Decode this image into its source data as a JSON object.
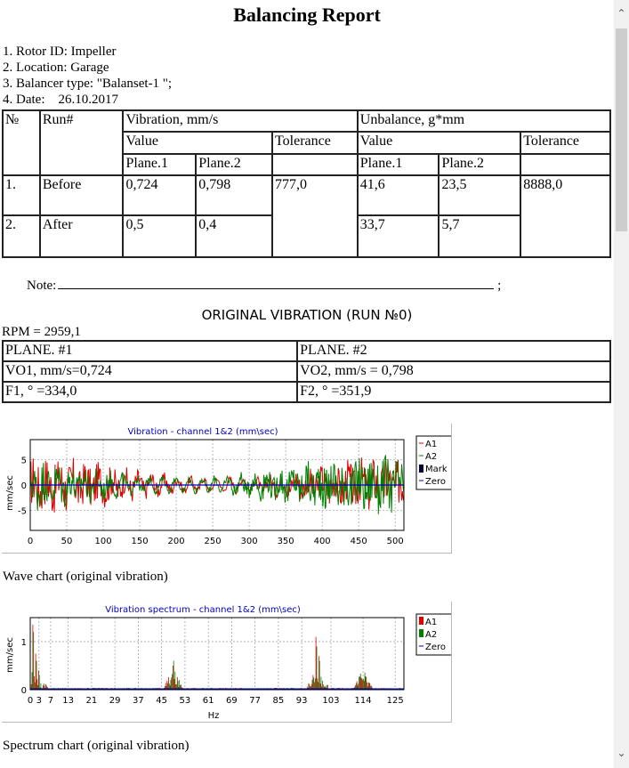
{
  "report": {
    "title": "Balancing Report",
    "info": [
      "1. Rotor ID: Impeller",
      "2. Location: Garage",
      "3. Balancer type: \"Balanset-1 \";",
      "4. Date:    26.10.2017"
    ]
  },
  "run_table": {
    "h_no": "№",
    "h_run": "Run#",
    "h_vib": "Vibration, mm/s",
    "h_unb": "Unbalance, g*mm",
    "h_value": "Value",
    "h_tol": "Tolerance",
    "h_p1": "Plane.1",
    "h_p2": "Plane.2",
    "rows": [
      {
        "no": "1.",
        "run": "Before",
        "v1": "0,724",
        "v2": "0,798",
        "vtol": "777,0",
        "u1": "41,6",
        "u2": "23,5",
        "utol": "8888,0"
      },
      {
        "no": "2.",
        "run": "After",
        "v1": "0,5",
        "v2": "0,4",
        "u1": "33,7",
        "u2": "5,7"
      }
    ]
  },
  "note": {
    "label": "Note:",
    "end": ";"
  },
  "original": {
    "heading": "ORIGINAL VIBRATION (RUN №0)",
    "rpm": "RPM = 2959,1",
    "plane1": {
      "name": "PLANE. #1",
      "vo": "VO1, mm/s=0,724",
      "f": "F1, ° =334,0"
    },
    "plane2": {
      "name": "PLANE. #2",
      "vo": "VO2, mm/s = 0,798",
      "f": "F2, ° =351,9"
    }
  },
  "wave_chart": {
    "title": "Vibration - channel 1&2 (mm\\sec)",
    "ylabel": "mm/sec",
    "legend": [
      "A1",
      "A2",
      "Mark",
      "Zero"
    ],
    "caption": "Wave chart (original vibration)",
    "chart_data": {
      "type": "line",
      "title": "Vibration - channel 1&2 (mm\\sec)",
      "ylabel": "mm/sec",
      "xlim": [
        0,
        512
      ],
      "ylim": [
        -9,
        9
      ],
      "x_ticks": [
        0,
        50,
        100,
        150,
        200,
        250,
        300,
        350,
        400,
        450,
        500
      ],
      "y_ticks": [
        5,
        0,
        -5
      ],
      "series": [
        {
          "name": "A1",
          "color": "#e00000",
          "amplitude": 5
        },
        {
          "name": "A2",
          "color": "#008000",
          "amplitude": 5
        },
        {
          "name": "Zero",
          "color": "#0000c0",
          "value": 0
        }
      ]
    }
  },
  "spectrum_chart": {
    "title": "Vibration spectrum - channel 1&2 (mm\\sec)",
    "ylabel": "mm/sec",
    "xlabel": "Hz",
    "legend": [
      "A1",
      "A2",
      "Zero"
    ],
    "caption": "Spectrum chart  (original vibration)",
    "chart_data": {
      "type": "bar",
      "title": "Vibration spectrum - channel 1&2 (mm\\sec)",
      "xlabel": "Hz",
      "ylabel": "mm/sec",
      "xlim": [
        0,
        128
      ],
      "ylim": [
        0,
        1.5
      ],
      "x_ticks": [
        0,
        3,
        7,
        13,
        21,
        29,
        37,
        45,
        53,
        61,
        69,
        77,
        85,
        93,
        103,
        114,
        125
      ],
      "y_ticks": [
        1,
        0
      ],
      "peaks": [
        {
          "hz": 1,
          "A1": 1.35,
          "A2": 1.2
        },
        {
          "hz": 2,
          "A1": 0.75,
          "A2": 0.6
        },
        {
          "hz": 3,
          "A1": 0.4,
          "A2": 0.3
        },
        {
          "hz": 49,
          "A1": 0.5,
          "A2": 0.6
        },
        {
          "hz": 98,
          "A1": 1.1,
          "A2": 0.9
        },
        {
          "hz": 99,
          "A1": 0.7,
          "A2": 0.6
        },
        {
          "hz": 114,
          "A1": 0.2,
          "A2": 0.22
        }
      ]
    }
  }
}
